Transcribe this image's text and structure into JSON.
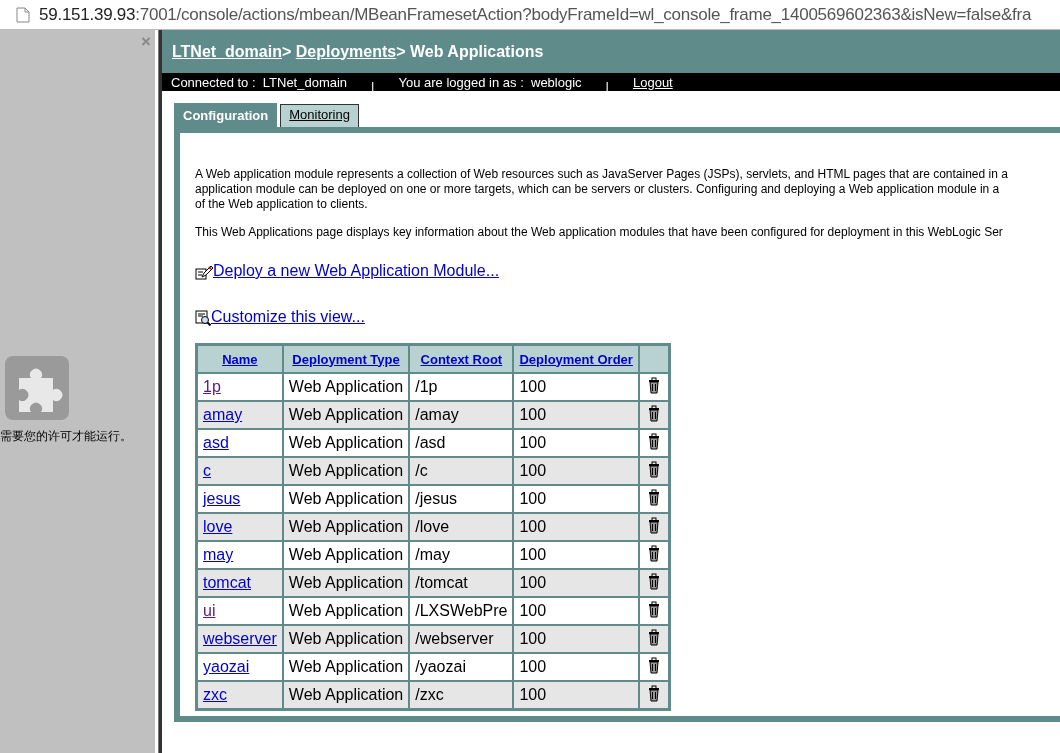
{
  "address_bar": {
    "url_host": "59.151.39.93",
    "url_rest": ":7001/console/actions/mbean/MBeanFramesetAction?bodyFrameId=wl_console_frame_1400569602363&isNew=false&fra"
  },
  "side_pane": {
    "close": "×",
    "message": "需要您的许可才能运行。"
  },
  "breadcrumb": [
    {
      "label": "LTNet_domain",
      "link": true
    },
    {
      "label": "> ",
      "link": false
    },
    {
      "label": "Deployments",
      "link": true
    },
    {
      "label": "> Web Applications",
      "link": false
    }
  ],
  "status_bar": {
    "connected_label": "Connected to :  LTNet_domain",
    "separator_1": "|",
    "user_label": "You are logged in as :  weblogic",
    "separator_2": "|",
    "logout": "Logout"
  },
  "tabs": [
    {
      "label": "Configuration",
      "selected": true
    },
    {
      "label": "Monitoring",
      "selected": false
    }
  ],
  "description": [
    [
      "A Web application module represents a collection of Web resources such as JavaServer Pages (JSPs), servlets, and HTML pages that are contained in a",
      "application module can be deployed on one or more targets, which can be servers or clusters. Configuring and deploying a Web application module in a",
      "of the Web application to clients."
    ],
    [
      "This Web Applications page displays key information about the Web application modules that have been configured for deployment in this WebLogic Ser"
    ]
  ],
  "actions": [
    {
      "kind": "deploy",
      "label": "Deploy a new Web Application Module..."
    },
    {
      "kind": "customize",
      "label": "Customize this view..."
    }
  ],
  "table": {
    "columns": [
      "Name",
      "Deployment Type",
      "Context Root",
      "Deployment Order"
    ],
    "rows": [
      {
        "name": "1p",
        "visited": true,
        "type": "Web Application",
        "context_root": "/1p",
        "order": "100"
      },
      {
        "name": "amay",
        "visited": false,
        "type": "Web Application",
        "context_root": "/amay",
        "order": "100"
      },
      {
        "name": "asd",
        "visited": false,
        "type": "Web Application",
        "context_root": "/asd",
        "order": "100"
      },
      {
        "name": "c",
        "visited": false,
        "type": "Web Application",
        "context_root": "/c",
        "order": "100"
      },
      {
        "name": "jesus",
        "visited": false,
        "type": "Web Application",
        "context_root": "/jesus",
        "order": "100"
      },
      {
        "name": "love",
        "visited": false,
        "type": "Web Application",
        "context_root": "/love",
        "order": "100"
      },
      {
        "name": "may",
        "visited": false,
        "type": "Web Application",
        "context_root": "/may",
        "order": "100"
      },
      {
        "name": "tomcat",
        "visited": false,
        "type": "Web Application",
        "context_root": "/tomcat",
        "order": "100"
      },
      {
        "name": "ui",
        "visited": true,
        "type": "Web Application",
        "context_root": "/LXSWebPre",
        "order": "100"
      },
      {
        "name": "webserver",
        "visited": false,
        "type": "Web Application",
        "context_root": "/webserver",
        "order": "100"
      },
      {
        "name": "yaozai",
        "visited": false,
        "type": "Web Application",
        "context_root": "/yaozai",
        "order": "100"
      },
      {
        "name": "zxc",
        "visited": false,
        "type": "Web Application",
        "context_root": "/zxc",
        "order": "100"
      }
    ]
  }
}
